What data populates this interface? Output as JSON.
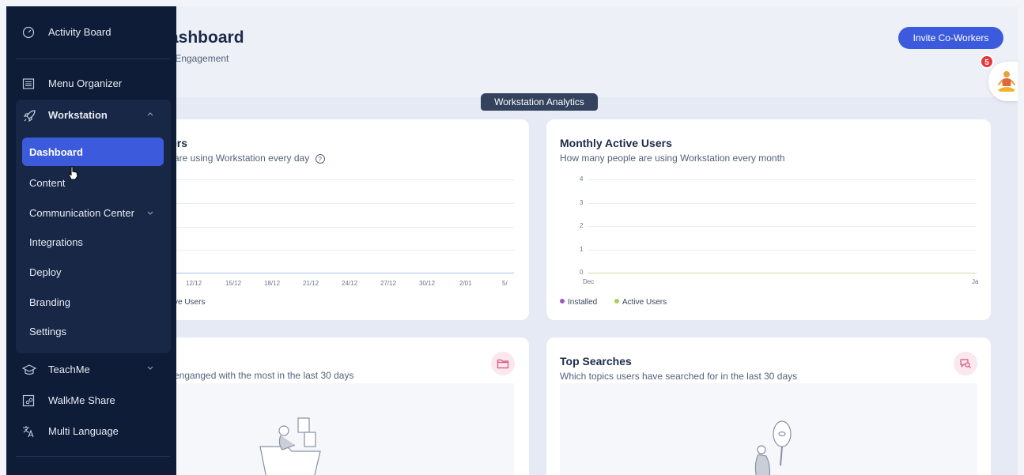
{
  "header": {
    "title": "ashboard",
    "subtitle": "r Engagement",
    "invite_button": "Invite Co-Workers",
    "notification_count": "5"
  },
  "section_tab": "Workstation Analytics",
  "cards": {
    "daily": {
      "title": "ers",
      "subtitle": "are using Workstation every day",
      "x_ticks": [
        "12/12",
        "15/12",
        "18/12",
        "21/12",
        "24/12",
        "27/12",
        "30/12",
        "2/01",
        "5/"
      ],
      "legend": "ve Users"
    },
    "monthly": {
      "title": "Monthly Active Users",
      "subtitle": "How many people are using Workstation every month",
      "y_ticks": [
        "4",
        "3",
        "2",
        "1",
        "0"
      ],
      "x_ticks": [
        "Dec",
        "Ja"
      ],
      "legend_installed": "Installed",
      "legend_active": "Active Users"
    },
    "content": {
      "subtitle": "enganged with the most in the last 30 days"
    },
    "searches": {
      "title": "Top Searches",
      "subtitle": "Which topics users have searched for in the last 30 days"
    }
  },
  "sidebar": {
    "activity_board": "Activity Board",
    "menu_organizer": "Menu Organizer",
    "workstation": "Workstation",
    "sub_items": {
      "dashboard": "Dashboard",
      "content": "Content",
      "communication_center": "Communication Center",
      "integrations": "Integrations",
      "deploy": "Deploy",
      "branding": "Branding",
      "settings": "Settings"
    },
    "teachme": "TeachMe",
    "walkme_share": "WalkMe Share",
    "multi_language": "Multi Language"
  },
  "colors": {
    "accent": "#3c5bdc",
    "sidebar_bg": "#0e1c37",
    "installed_series": "#9b59c6",
    "active_series": "#a8d05a",
    "badge": "#e5363b"
  }
}
